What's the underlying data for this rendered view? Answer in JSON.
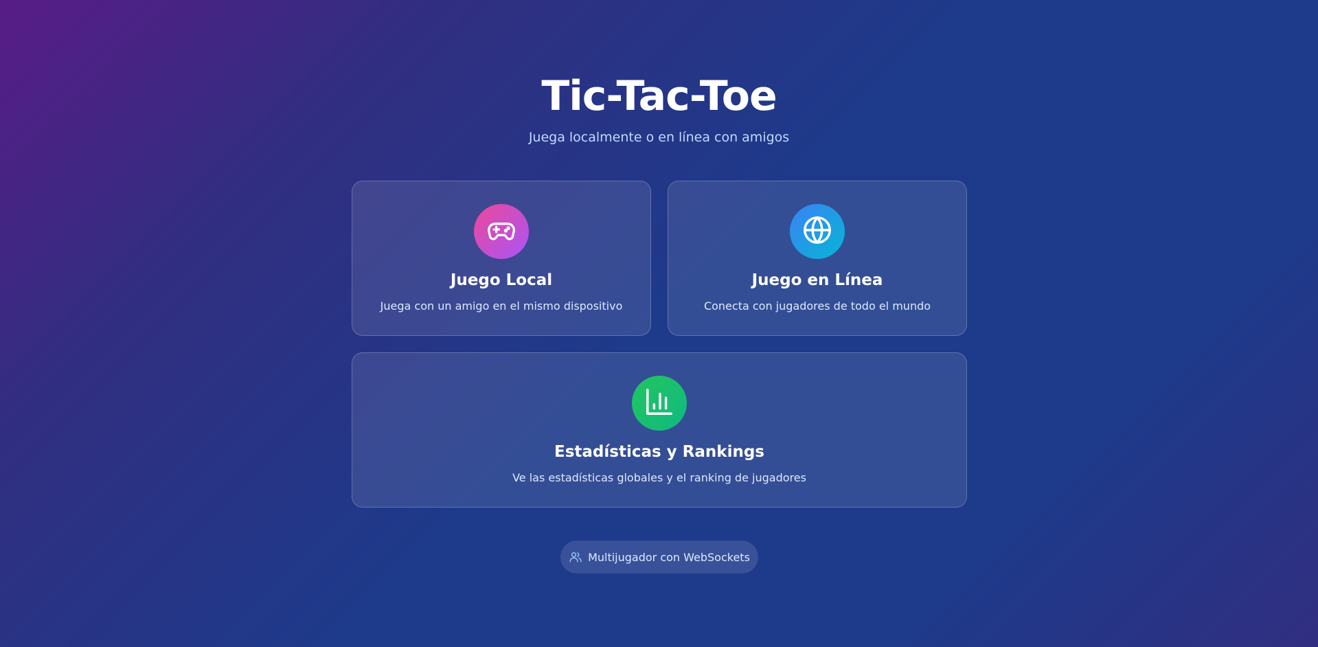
{
  "header": {
    "title": "Tic-Tac-Toe",
    "subtitle": "Juega localmente o en línea con amigos"
  },
  "modes": {
    "local": {
      "icon": "gamepad-icon",
      "title": "Juego Local",
      "description": "Juega con un amigo en el mismo dispositivo",
      "gradient": [
        "#ec4899",
        "#a855f7"
      ]
    },
    "online": {
      "icon": "globe-icon",
      "title": "Juego en Línea",
      "description": "Conecta con jugadores de todo el mundo",
      "gradient": [
        "#3b82f6",
        "#06b6d4"
      ]
    },
    "stats": {
      "icon": "bar-chart-icon",
      "title": "Estadísticas y Rankings",
      "description": "Ve las estadísticas globales y el ranking de jugadores",
      "gradient": [
        "#22c55e",
        "#10b981"
      ]
    }
  },
  "footer_badge": {
    "icon": "users-icon",
    "label": "Multijugador con WebSockets"
  },
  "colors": {
    "background_start": "#581c87",
    "background_end": "#1e3a8a",
    "subtitle_text": "#bfdbfe"
  }
}
